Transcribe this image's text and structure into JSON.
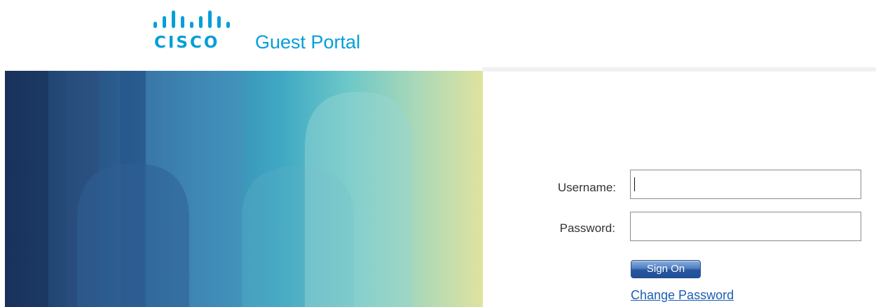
{
  "header": {
    "logo_word": "CISCO",
    "portal_title": "Guest Portal",
    "brand_color": "#049fd9"
  },
  "login": {
    "username_label": "Username:",
    "username_value": "",
    "password_label": "Password:",
    "password_value": "",
    "signon_label": "Sign On",
    "change_password_label": "Change Password"
  },
  "colors": {
    "banner_dark": "#1b3a66",
    "banner_mid": "#3a9cc0",
    "banner_light": "#d8e3a5",
    "link": "#1a5fb4",
    "button": "#28579f"
  }
}
